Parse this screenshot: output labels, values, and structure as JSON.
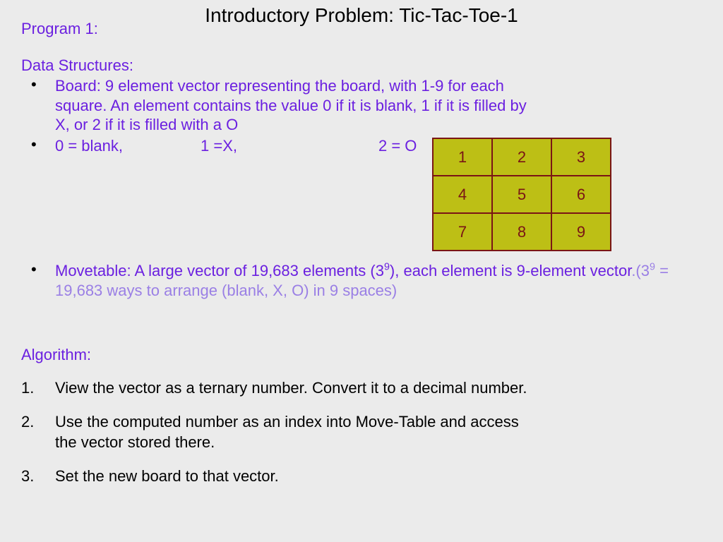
{
  "title": "Introductory Problem: Tic-Tac-Toe-1",
  "program_label": "Program 1:",
  "ds_heading": "Data Structures:",
  "bullets": {
    "b1": "Board: 9 element vector representing the board, with 1-9 for each square. An element contains the value 0 if it is blank, 1 if it is filled by X, or 2 if it is filled with a O",
    "b2a": "0 = blank,",
    "b2b": "1 =X,",
    "b2c": "2 = O"
  },
  "movetable": {
    "part1": "Movetable: A large vector of 19,683 elements (",
    "base": "3",
    "exp": "9",
    "part2": "), each element  is 9-element vector",
    "paren_open": ".(",
    "base2": "3",
    "exp2": "9",
    "paren_rest": " = 19,683 ways to arrange (blank, X, O) in 9 spaces)"
  },
  "algo_heading": "Algorithm:",
  "steps": {
    "n1": "1.",
    "s1": "View the vector as a ternary number. Convert it to a decimal number.",
    "n2": "2.",
    "s2": "Use the computed number as an index into Move-Table and access the vector stored there.",
    "n3": "3.",
    "s3": "Set the new board to that vector."
  },
  "grid": {
    "c1": "1",
    "c2": "2",
    "c3": "3",
    "c4": "4",
    "c5": "5",
    "c6": "6",
    "c7": "7",
    "c8": "8",
    "c9": "9"
  }
}
